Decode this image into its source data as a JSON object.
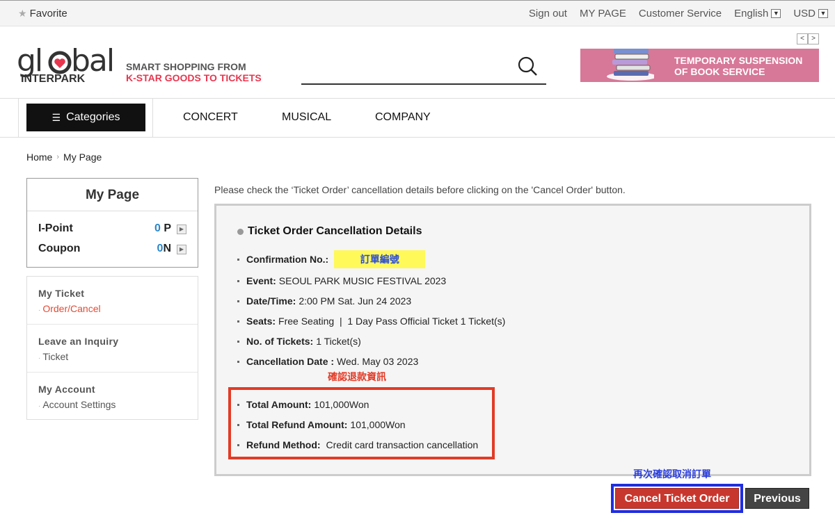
{
  "topbar": {
    "favorite": "Favorite",
    "sign_out": "Sign out",
    "my_page": "MY PAGE",
    "customer_service": "Customer Service",
    "language": "English",
    "currency": "USD"
  },
  "header": {
    "logo_top": "global",
    "logo_bottom": "INTERPARK",
    "tagline_1": "SMART SHOPPING FROM",
    "tagline_2": "K-STAR GOODS TO TICKETS",
    "banner_line1": "TEMPORARY SUSPENSION",
    "banner_line2": "OF BOOK SERVICE",
    "banner_prev": "<",
    "banner_next": ">",
    "banner_color": "#d77898"
  },
  "nav": {
    "categories": "Categories",
    "items": [
      "CONCERT",
      "MUSICAL",
      "COMPANY"
    ]
  },
  "breadcrumb": {
    "home": "Home",
    "current": "My Page"
  },
  "sidebar": {
    "title": "My Page",
    "ipoint_label": "I-Point",
    "ipoint_num": "0",
    "ipoint_unit": " P",
    "coupon_label": "Coupon",
    "coupon_num": "0",
    "coupon_unit": "N",
    "groups": [
      {
        "title": "My Ticket",
        "sub": "Order/Cancel"
      },
      {
        "title": "Leave an Inquiry",
        "sub": "Ticket"
      },
      {
        "title": "My Account",
        "sub": "Account Settings"
      }
    ]
  },
  "main": {
    "notice": "Please check the ‘Ticket Order’ cancellation details before clicking on the 'Cancel Order' button.",
    "panel_title": "Ticket Order Cancellation Details",
    "confirmation_label": "Confirmation No.:",
    "confirmation_value": "訂單編號",
    "event_label": "Event:",
    "event_value": "SEOUL PARK MUSIC FESTIVAL 2023",
    "datetime_label": "Date/Time:",
    "datetime_value": "2:00 PM Sat. Jun 24 2023",
    "seats_label": "Seats:",
    "seats_value": "Free Seating  |  1 Day Pass Official Ticket 1 Ticket(s)",
    "tickets_label": "No. of Tickets:",
    "tickets_value": "1 Ticket(s)",
    "canceldate_label": "Cancellation Date :",
    "canceldate_value": "Wed. May 03 2023",
    "refund_note": "確認退款資訊",
    "total_label": "Total Amount:",
    "total_value": "101,000Won",
    "refund_label": "Total Refund Amount:",
    "refund_value": "101,000Won",
    "method_label": "Refund Method:",
    "method_value": "Credit card transaction cancellation",
    "confirm_note": "再次確認取消訂單",
    "cancel_button": "Cancel Ticket Order",
    "previous_button": "Previous"
  }
}
